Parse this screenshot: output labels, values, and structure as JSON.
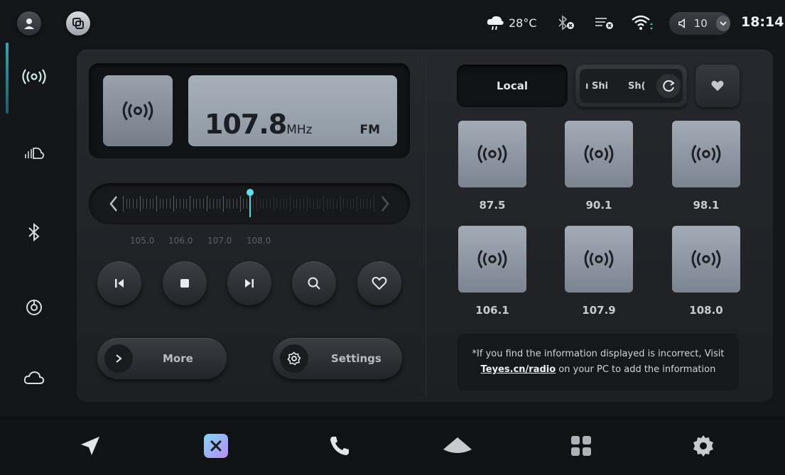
{
  "status_bar": {
    "weather_icon": "cloud-rain-icon",
    "temperature": "28°C",
    "bluetooth_icon": "bluetooth-off-icon",
    "media_icon": "playlist-off-icon",
    "wifi_icon": "wifi-icon",
    "volume_icon": "speaker-icon",
    "volume_value": "10",
    "time": "18:14"
  },
  "sidebar": {
    "items": [
      {
        "name": "radio",
        "icon": "radio-waves-icon"
      },
      {
        "name": "music",
        "icon": "soundcloud-icon"
      },
      {
        "name": "bluetooth",
        "icon": "bluetooth-icon"
      },
      {
        "name": "disc",
        "icon": "disc-icon"
      },
      {
        "name": "cloud",
        "icon": "cloud-icon"
      }
    ]
  },
  "tuner": {
    "frequency": "107.8",
    "unit": "MHz",
    "band": "FM",
    "scale_labels": [
      "105.0",
      "106.0",
      "107.0",
      "108.0"
    ]
  },
  "controls": {
    "more_label": "More",
    "settings_label": "Settings"
  },
  "tabs": {
    "local_label": "Local",
    "scroll_label_a": "ı Shi",
    "scroll_label_b": "Sh("
  },
  "presets": [
    {
      "freq": "87.5"
    },
    {
      "freq": "90.1"
    },
    {
      "freq": "98.1"
    },
    {
      "freq": "106.1"
    },
    {
      "freq": "107.9"
    },
    {
      "freq": "108.0"
    }
  ],
  "info": {
    "line1": "*If you find the information displayed is incorrect, Visit",
    "link": "Teyes.cn/radio",
    "line2_rest": " on your PC to add the information"
  },
  "colors": {
    "accent": "#4fd4e0",
    "background": "#141518",
    "preset_tile": "#8f98a4"
  }
}
